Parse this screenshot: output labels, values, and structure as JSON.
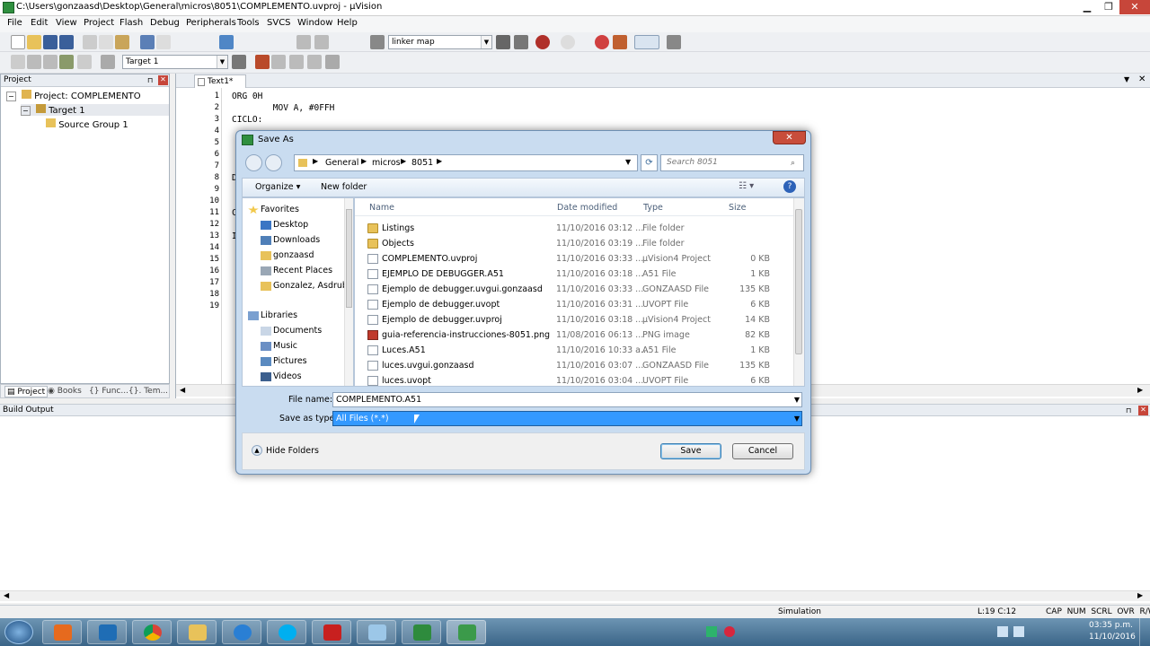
{
  "window": {
    "title": "C:\\Users\\gonzaasd\\Desktop\\General\\micros\\8051\\COMPLEMENTO.uvproj - µVision"
  },
  "menu": [
    "File",
    "Edit",
    "View",
    "Project",
    "Flash",
    "Debug",
    "Peripherals",
    "Tools",
    "SVCS",
    "Window",
    "Help"
  ],
  "toolbar": {
    "find_combo": "linker map",
    "target_combo": "Target 1"
  },
  "project_panel": {
    "header": "Project",
    "tree": {
      "root": "Project: COMPLEMENTO",
      "target": "Target 1",
      "group": "Source Group 1"
    },
    "tabs": [
      "Project",
      "Books",
      "Func...",
      "Tem..."
    ]
  },
  "editor": {
    "tab": "Text1*",
    "line_numbers": [
      "1",
      "2",
      "3",
      "4",
      "5",
      "6",
      "7",
      "8",
      "9",
      "10",
      "11",
      "12",
      "13",
      "14",
      "15",
      "16",
      "17",
      "18",
      "19"
    ],
    "code_lines": [
      "ORG 0H",
      "        MOV A, #0FFH",
      "CICLO:"
    ],
    "partial_chars": [
      "D",
      "C",
      "I"
    ]
  },
  "build_output": {
    "header": "Build Output"
  },
  "status": {
    "mode": "Simulation",
    "position": "L:19 C:12",
    "indicators": "CAP  NUM  SCRL  OVR  R/W"
  },
  "taskbar": {
    "time": "03:35 p.m.",
    "date": "11/10/2016"
  },
  "dialog": {
    "title": "Save As",
    "breadcrumb": [
      "General",
      "micros",
      "8051"
    ],
    "search_placeholder": "Search 8051",
    "organize": "Organize ▾",
    "new_folder": "New folder",
    "nav": {
      "favorites": "Favorites",
      "favorite_items": [
        "Desktop",
        "Downloads",
        "gonzaasd",
        "Recent Places",
        "Gonzalez, Asdrub"
      ],
      "libraries": "Libraries",
      "library_items": [
        "Documents",
        "Music",
        "Pictures",
        "Videos"
      ]
    },
    "columns": {
      "name": "Name",
      "date": "Date modified",
      "type": "Type",
      "size": "Size"
    },
    "files": [
      {
        "name": "Listings",
        "date": "11/10/2016 03:12 ...",
        "type": "File folder",
        "size": "",
        "kind": "folder"
      },
      {
        "name": "Objects",
        "date": "11/10/2016 03:19 ...",
        "type": "File folder",
        "size": "",
        "kind": "folder"
      },
      {
        "name": "COMPLEMENTO.uvproj",
        "date": "11/10/2016 03:33 ...",
        "type": "µVision4 Project",
        "size": "0 KB",
        "kind": "file"
      },
      {
        "name": "EJEMPLO DE DEBUGGER.A51",
        "date": "11/10/2016 03:18 ...",
        "type": "A51 File",
        "size": "1 KB",
        "kind": "file"
      },
      {
        "name": "Ejemplo de debugger.uvgui.gonzaasd",
        "date": "11/10/2016 03:33 ...",
        "type": "GONZAASD File",
        "size": "135 KB",
        "kind": "file"
      },
      {
        "name": "Ejemplo de debugger.uvopt",
        "date": "11/10/2016 03:31 ...",
        "type": "UVOPT File",
        "size": "6 KB",
        "kind": "file"
      },
      {
        "name": "Ejemplo de debugger.uvproj",
        "date": "11/10/2016 03:18 ...",
        "type": "µVision4 Project",
        "size": "14 KB",
        "kind": "file"
      },
      {
        "name": "guia-referencia-instrucciones-8051.png",
        "date": "11/08/2016 06:13 ...",
        "type": "PNG image",
        "size": "82 KB",
        "kind": "png"
      },
      {
        "name": "Luces.A51",
        "date": "11/10/2016 10:33 a...",
        "type": "A51 File",
        "size": "1 KB",
        "kind": "file"
      },
      {
        "name": "luces.uvgui.gonzaasd",
        "date": "11/10/2016 03:07 ...",
        "type": "GONZAASD File",
        "size": "135 KB",
        "kind": "file"
      },
      {
        "name": "luces.uvopt",
        "date": "11/10/2016 03:04 ...",
        "type": "UVOPT File",
        "size": "6 KB",
        "kind": "file"
      }
    ],
    "file_name_label": "File name:",
    "file_name_value": "COMPLEMENTO.A51",
    "save_type_label": "Save as type:",
    "save_type_value": "All Files (*.*)",
    "hide_folders": "Hide Folders",
    "save_button": "Save",
    "cancel_button": "Cancel"
  }
}
